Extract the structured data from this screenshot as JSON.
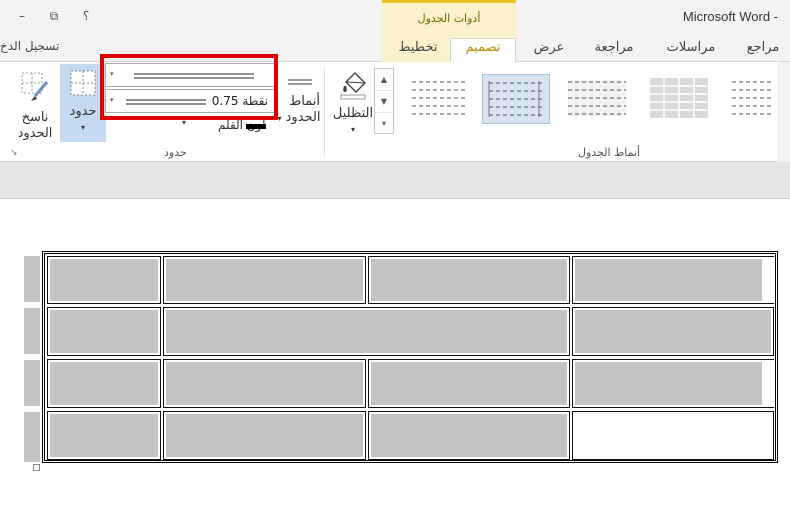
{
  "window": {
    "app_title": "Microsoft Word - ",
    "minimize": "–",
    "restore": "⧉",
    "help": "؟",
    "context_group": "أدوات الجدول"
  },
  "tabs": {
    "signin": "تسجيل الدخ",
    "layout": "تخطيط",
    "design": "تصميم",
    "view": "عرض",
    "review": "مراجعة",
    "mailings": "مراسلات",
    "references": "مراجع"
  },
  "ribbon": {
    "border_painter_line1": "ناسخ",
    "border_painter_line2": "الحدود",
    "borders": "حدود",
    "pen_color": "لون القلم",
    "border_styles_line1": "أنماط",
    "border_styles_line2": "الحدود",
    "line_weight": "0.75 نقطة",
    "group_borders": "حدود",
    "shading": "التظليل",
    "group_table_styles": "أنماط الجدول",
    "borders_dropdown": "▾",
    "pen_color_dropdown": "▾",
    "border_styles_dropdown": "▾",
    "shading_dropdown": "▾",
    "dialog_launcher": "↘",
    "gallery_up": "▲",
    "gallery_down": "▼",
    "gallery_more": "▾"
  },
  "colors": {
    "accent_gold": "#e8c12b",
    "context_bg": "#fbf2cc",
    "highlight_red": "#e00000",
    "cell_shading": "#c4c4c4",
    "selected_button": "#c5d9f1"
  }
}
